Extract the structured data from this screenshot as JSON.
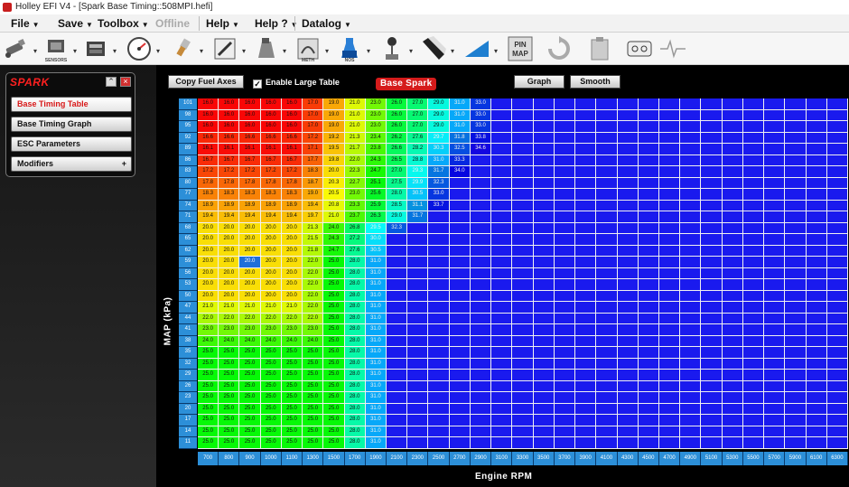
{
  "window": {
    "title": "Holley EFI V4 - [Spark Base Timing::508MPI.hefi]"
  },
  "menu": [
    {
      "label": "File",
      "caret": true
    },
    {
      "label": "Save",
      "caret": true
    },
    {
      "label": "Toolbox",
      "caret": true
    },
    {
      "label": "Offline",
      "caret": false,
      "disabled": true
    },
    {
      "label": "Help",
      "caret": true
    },
    {
      "label": "Help ?",
      "caret": true
    },
    {
      "label": "Datalog",
      "caret": true
    }
  ],
  "toolbar": {
    "sensors_label": "SENSORS",
    "meth_label": "METH",
    "nos_label": "NOS",
    "pinmap_label": "PIN MAP",
    "buttons": [
      "injector-icon",
      "sensors-icon",
      "ecu-icon",
      "gauge-icon",
      "spark-plug-icon",
      "timing-icon",
      "ignition-icon",
      "meth-icon",
      "nos-icon",
      "shifter-icon",
      "stripe-icon",
      "ramp-icon",
      "pinmap-icon",
      "refresh-icon",
      "clipboard-icon",
      "tape-icon",
      "heartbeat-icon"
    ]
  },
  "spark_panel": {
    "title": "SPARK",
    "items": [
      {
        "label": "Base Timing Table",
        "active": true
      },
      {
        "label": "Base Timing Graph",
        "active": false
      },
      {
        "label": "ESC Parameters",
        "active": false
      },
      {
        "label": "Modifiers",
        "active": false,
        "plus": "+"
      }
    ]
  },
  "main": {
    "copy_button": "Copy Fuel Axes",
    "large_table_label": "Enable Large Table",
    "large_table_checked": true,
    "badge": "Base Spark",
    "graph_button": "Graph",
    "smooth_button": "Smooth"
  },
  "axes": {
    "y_label": "MAP (kPa)",
    "x_label": "Engine RPM",
    "map": [
      101,
      98,
      95,
      92,
      89,
      86,
      83,
      80,
      77,
      74,
      71,
      68,
      65,
      62,
      59,
      56,
      53,
      50,
      47,
      44,
      41,
      38,
      35,
      32,
      29,
      26,
      23,
      20,
      17,
      14,
      11
    ],
    "rpm": [
      700,
      800,
      900,
      1000,
      1100,
      1300,
      1500,
      1700,
      1900,
      2100,
      2300,
      2500,
      2700,
      2900,
      3100,
      3300,
      3500,
      3700,
      3900,
      4100,
      4300,
      4500,
      4700,
      4900,
      5100,
      5300,
      5500,
      5700,
      5900,
      6100,
      6300
    ]
  },
  "table": {
    "selected": {
      "row": 14,
      "col": 2
    },
    "rows": [
      [
        "16.0",
        "16.0",
        "16.0",
        "16.0",
        "16.0",
        "17.0",
        "19.0",
        "21.0",
        "23.0",
        "26.0",
        "27.0",
        "29.0",
        "31.0",
        "33.0",
        "",
        "",
        "",
        "",
        "",
        "",
        "",
        "",
        "",
        "",
        "",
        "",
        "",
        "",
        "",
        "",
        ""
      ],
      [
        "16.0",
        "16.0",
        "16.0",
        "16.0",
        "16.0",
        "17.0",
        "19.0",
        "21.0",
        "23.0",
        "26.0",
        "27.0",
        "29.0",
        "31.0",
        "33.0",
        "",
        "",
        "",
        "",
        "",
        "",
        "",
        "",
        "",
        "",
        "",
        "",
        "",
        "",
        "",
        "",
        ""
      ],
      [
        "16.0",
        "16.0",
        "16.0",
        "16.0",
        "16.0",
        "17.0",
        "19.0",
        "21.0",
        "23.0",
        "26.0",
        "27.0",
        "29.0",
        "31.0",
        "33.0",
        "",
        "",
        "",
        "",
        "",
        "",
        "",
        "",
        "",
        "",
        "",
        "",
        "",
        "",
        "",
        "",
        ""
      ],
      [
        "16.6",
        "16.6",
        "16.6",
        "16.6",
        "16.6",
        "17.2",
        "19.2",
        "21.3",
        "23.4",
        "26.2",
        "27.6",
        "29.7",
        "31.8",
        "33.8",
        "",
        "",
        "",
        "",
        "",
        "",
        "",
        "",
        "",
        "",
        "",
        "",
        "",
        "",
        "",
        "",
        ""
      ],
      [
        "16.1",
        "16.1",
        "16.1",
        "16.1",
        "16.1",
        "17.1",
        "19.5",
        "21.7",
        "23.8",
        "26.6",
        "28.2",
        "30.3",
        "32.5",
        "34.6",
        "",
        "",
        "",
        "",
        "",
        "",
        "",
        "",
        "",
        "",
        "",
        "",
        "",
        "",
        "",
        "",
        ""
      ],
      [
        "16.7",
        "16.7",
        "16.7",
        "16.7",
        "16.7",
        "17.7",
        "19.8",
        "22.0",
        "24.3",
        "26.5",
        "28.8",
        "31.0",
        "33.3",
        "",
        "",
        "",
        "",
        "",
        "",
        "",
        "",
        "",
        "",
        "",
        "",
        "",
        "",
        "",
        "",
        "",
        ""
      ],
      [
        "17.2",
        "17.2",
        "17.2",
        "17.2",
        "17.2",
        "18.3",
        "20.0",
        "22.3",
        "24.7",
        "27.0",
        "29.3",
        "31.7",
        "34.0",
        "",
        "",
        "",
        "",
        "",
        "",
        "",
        "",
        "",
        "",
        "",
        "",
        "",
        "",
        "",
        "",
        "",
        ""
      ],
      [
        "17.8",
        "17.8",
        "17.8",
        "17.8",
        "17.8",
        "18.7",
        "20.3",
        "22.7",
        "25.1",
        "27.5",
        "29.9",
        "32.3",
        "",
        "",
        "",
        "",
        "",
        "",
        "",
        "",
        "",
        "",
        "",
        "",
        "",
        "",
        "",
        "",
        "",
        "",
        ""
      ],
      [
        "18.3",
        "18.3",
        "18.3",
        "18.3",
        "18.3",
        "19.0",
        "20.5",
        "23.0",
        "25.6",
        "28.0",
        "30.5",
        "33.0",
        "",
        "",
        "",
        "",
        "",
        "",
        "",
        "",
        "",
        "",
        "",
        "",
        "",
        "",
        "",
        "",
        "",
        "",
        ""
      ],
      [
        "18.9",
        "18.9",
        "18.9",
        "18.9",
        "18.9",
        "19.4",
        "20.8",
        "23.3",
        "25.9",
        "28.5",
        "31.1",
        "33.7",
        "",
        "",
        "",
        "",
        "",
        "",
        "",
        "",
        "",
        "",
        "",
        "",
        "",
        "",
        "",
        "",
        "",
        "",
        ""
      ],
      [
        "19.4",
        "19.4",
        "19.4",
        "19.4",
        "19.4",
        "19.7",
        "21.0",
        "23.7",
        "26.3",
        "29.0",
        "31.7",
        "",
        "",
        "",
        "",
        "",
        "",
        "",
        "",
        "",
        "",
        "",
        "",
        "",
        "",
        "",
        "",
        "",
        "",
        "",
        ""
      ],
      [
        "20.0",
        "20.0",
        "20.0",
        "20.0",
        "20.0",
        "21.3",
        "24.0",
        "26.8",
        "29.5",
        "32.3",
        "",
        "",
        "",
        "",
        "",
        "",
        "",
        "",
        "",
        "",
        "",
        "",
        "",
        "",
        "",
        "",
        "",
        "",
        "",
        "",
        ""
      ],
      [
        "20.0",
        "20.0",
        "20.0",
        "20.0",
        "20.0",
        "21.5",
        "24.3",
        "27.2",
        "30.0",
        "",
        "",
        "",
        "",
        "",
        "",
        "",
        "",
        "",
        "",
        "",
        "",
        "",
        "",
        "",
        "",
        "",
        "",
        "",
        "",
        "",
        ""
      ],
      [
        "20.0",
        "20.0",
        "20.0",
        "20.0",
        "20.0",
        "21.8",
        "24.7",
        "27.6",
        "30.5",
        "",
        "",
        "",
        "",
        "",
        "",
        "",
        "",
        "",
        "",
        "",
        "",
        "",
        "",
        "",
        "",
        "",
        "",
        "",
        "",
        "",
        ""
      ],
      [
        "20.0",
        "20.0",
        "20.0",
        "20.0",
        "20.0",
        "22.0",
        "25.0",
        "28.0",
        "31.0",
        "",
        "",
        "",
        "",
        "",
        "",
        "",
        "",
        "",
        "",
        "",
        "",
        "",
        "",
        "",
        "",
        "",
        "",
        "",
        "",
        "",
        ""
      ],
      [
        "20.0",
        "20.0",
        "20.0",
        "20.0",
        "20.0",
        "22.0",
        "25.0",
        "28.0",
        "31.0",
        "",
        "",
        "",
        "",
        "",
        "",
        "",
        "",
        "",
        "",
        "",
        "",
        "",
        "",
        "",
        "",
        "",
        "",
        "",
        "",
        "",
        ""
      ],
      [
        "20.0",
        "20.0",
        "20.0",
        "20.0",
        "20.0",
        "22.0",
        "25.0",
        "28.0",
        "31.0",
        "",
        "",
        "",
        "",
        "",
        "",
        "",
        "",
        "",
        "",
        "",
        "",
        "",
        "",
        "",
        "",
        "",
        "",
        "",
        "",
        "",
        ""
      ],
      [
        "20.0",
        "20.0",
        "20.0",
        "20.0",
        "20.0",
        "22.0",
        "25.0",
        "28.0",
        "31.0",
        "",
        "",
        "",
        "",
        "",
        "",
        "",
        "",
        "",
        "",
        "",
        "",
        "",
        "",
        "",
        "",
        "",
        "",
        "",
        "",
        "",
        ""
      ],
      [
        "21.0",
        "21.0",
        "21.0",
        "21.0",
        "21.0",
        "22.0",
        "25.0",
        "28.0",
        "31.0",
        "",
        "",
        "",
        "",
        "",
        "",
        "",
        "",
        "",
        "",
        "",
        "",
        "",
        "",
        "",
        "",
        "",
        "",
        "",
        "",
        "",
        ""
      ],
      [
        "22.0",
        "22.0",
        "22.0",
        "22.0",
        "22.0",
        "22.0",
        "25.0",
        "28.0",
        "31.0",
        "",
        "",
        "",
        "",
        "",
        "",
        "",
        "",
        "",
        "",
        "",
        "",
        "",
        "",
        "",
        "",
        "",
        "",
        "",
        "",
        "",
        ""
      ],
      [
        "23.0",
        "23.0",
        "23.0",
        "23.0",
        "23.0",
        "23.0",
        "25.0",
        "28.0",
        "31.0",
        "",
        "",
        "",
        "",
        "",
        "",
        "",
        "",
        "",
        "",
        "",
        "",
        "",
        "",
        "",
        "",
        "",
        "",
        "",
        "",
        "",
        ""
      ],
      [
        "24.0",
        "24.0",
        "24.0",
        "24.0",
        "24.0",
        "24.0",
        "25.0",
        "28.0",
        "31.0",
        "",
        "",
        "",
        "",
        "",
        "",
        "",
        "",
        "",
        "",
        "",
        "",
        "",
        "",
        "",
        "",
        "",
        "",
        "",
        "",
        "",
        ""
      ],
      [
        "25.0",
        "25.0",
        "25.0",
        "25.0",
        "25.0",
        "25.0",
        "25.0",
        "28.0",
        "31.0",
        "",
        "",
        "",
        "",
        "",
        "",
        "",
        "",
        "",
        "",
        "",
        "",
        "",
        "",
        "",
        "",
        "",
        "",
        "",
        "",
        "",
        ""
      ],
      [
        "25.0",
        "25.0",
        "25.0",
        "25.0",
        "25.0",
        "25.0",
        "25.0",
        "28.0",
        "31.0",
        "",
        "",
        "",
        "",
        "",
        "",
        "",
        "",
        "",
        "",
        "",
        "",
        "",
        "",
        "",
        "",
        "",
        "",
        "",
        "",
        "",
        ""
      ],
      [
        "25.0",
        "25.0",
        "25.0",
        "25.0",
        "25.0",
        "25.0",
        "25.0",
        "28.0",
        "31.0",
        "",
        "",
        "",
        "",
        "",
        "",
        "",
        "",
        "",
        "",
        "",
        "",
        "",
        "",
        "",
        "",
        "",
        "",
        "",
        "",
        "",
        ""
      ],
      [
        "25.0",
        "25.0",
        "25.0",
        "25.0",
        "25.0",
        "25.0",
        "25.0",
        "28.0",
        "31.0",
        "",
        "",
        "",
        "",
        "",
        "",
        "",
        "",
        "",
        "",
        "",
        "",
        "",
        "",
        "",
        "",
        "",
        "",
        "",
        "",
        "",
        ""
      ],
      [
        "25.0",
        "25.0",
        "25.0",
        "25.0",
        "25.0",
        "25.0",
        "25.0",
        "28.0",
        "31.0",
        "",
        "",
        "",
        "",
        "",
        "",
        "",
        "",
        "",
        "",
        "",
        "",
        "",
        "",
        "",
        "",
        "",
        "",
        "",
        "",
        "",
        ""
      ],
      [
        "25.0",
        "25.0",
        "25.0",
        "25.0",
        "25.0",
        "25.0",
        "25.0",
        "28.0",
        "31.0",
        "",
        "",
        "",
        "",
        "",
        "",
        "",
        "",
        "",
        "",
        "",
        "",
        "",
        "",
        "",
        "",
        "",
        "",
        "",
        "",
        "",
        ""
      ],
      [
        "25.0",
        "25.0",
        "25.0",
        "25.0",
        "25.0",
        "25.0",
        "25.0",
        "28.0",
        "31.0",
        "",
        "",
        "",
        "",
        "",
        "",
        "",
        "",
        "",
        "",
        "",
        "",
        "",
        "",
        "",
        "",
        "",
        "",
        "",
        "",
        "",
        ""
      ],
      [
        "25.0",
        "25.0",
        "25.0",
        "25.0",
        "25.0",
        "25.0",
        "25.0",
        "28.0",
        "31.0",
        "",
        "",
        "",
        "",
        "",
        "",
        "",
        "",
        "",
        "",
        "",
        "",
        "",
        "",
        "",
        "",
        "",
        "",
        "",
        "",
        "",
        ""
      ],
      [
        "25.0",
        "25.0",
        "25.0",
        "25.0",
        "25.0",
        "25.0",
        "25.0",
        "28.0",
        "31.0",
        "",
        "",
        "",
        "",
        "",
        "",
        "",
        "",
        "",
        "",
        "",
        "",
        "",
        "",
        "",
        "",
        "",
        "",
        "",
        "",
        "",
        ""
      ]
    ]
  }
}
